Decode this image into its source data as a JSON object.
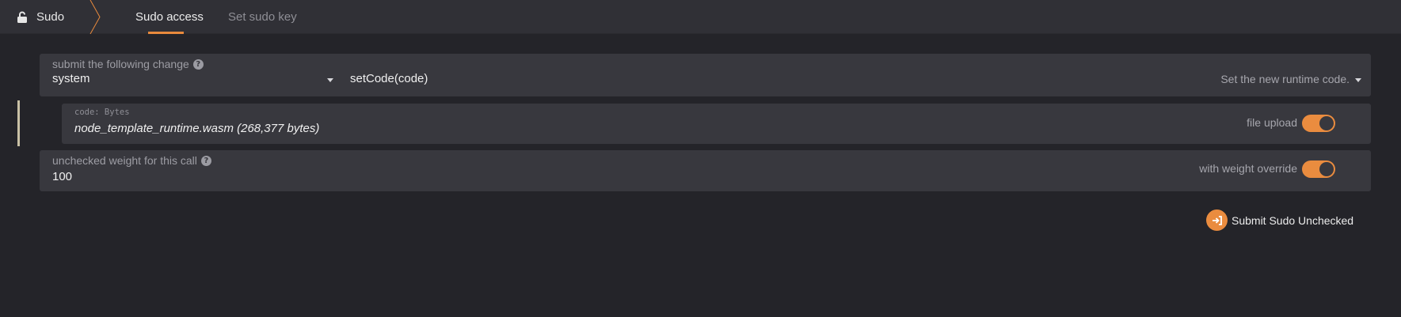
{
  "header": {
    "app_label": "Sudo",
    "tabs": [
      {
        "label": "Sudo access",
        "active": true
      },
      {
        "label": "Set sudo key",
        "active": false
      }
    ]
  },
  "change": {
    "label": "submit the following change",
    "section_value": "system",
    "method_value": "setCode(code)",
    "method_description": "Set the new runtime code."
  },
  "code_param": {
    "type_label": "code: Bytes",
    "value": "node_template_runtime.wasm (268,377 bytes)",
    "toggle_label": "file upload",
    "toggle_on": true
  },
  "weight": {
    "label": "unchecked weight for this call",
    "value": "100",
    "toggle_label": "with weight override",
    "toggle_on": true
  },
  "submit": {
    "label": "Submit Sudo Unchecked"
  },
  "colors": {
    "accent": "#ea8c3f",
    "background": "#242429",
    "panel": "#38383e"
  }
}
